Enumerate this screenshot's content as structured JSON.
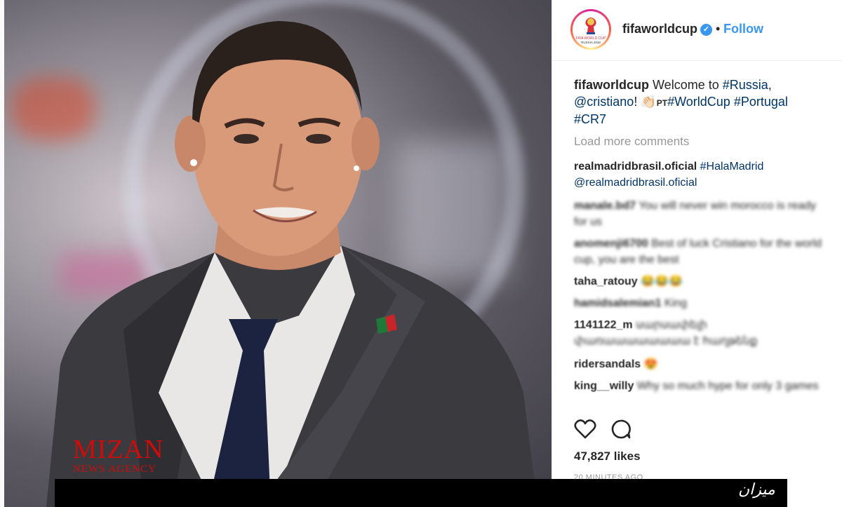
{
  "post": {
    "username": "fifaworldcup",
    "verified_icon": "verified-badge-icon",
    "separator": "•",
    "follow_label": "Follow",
    "caption": {
      "username": "fifaworldcup",
      "text_1": "Welcome to ",
      "tag_russia": "#Russia",
      "text_2": ",",
      "mention": "@cristiano",
      "text_3": "! 👏🏻",
      "pt": "PT",
      "tag_worldcup": "#WorldCup",
      "tag_portugal": "#Portugal",
      "tag_cr7": "#CR7"
    },
    "load_more": "Load more comments",
    "comments": [
      {
        "user": "realmadridbrasil.oficial",
        "text": "#HalaMadrid @realmadridbrasil.oficial"
      },
      {
        "user": "manale.bd7",
        "text": "You will never win morocco is ready for us"
      },
      {
        "user": "anomenji6700",
        "text": "Best of luck Cristiano for the world cup, you are the best"
      },
      {
        "user": "taha_ratouy",
        "text": "😂😂😂"
      },
      {
        "user": "hamidsalemian1",
        "text": "King"
      },
      {
        "user": "1141122_m",
        "text": "սարսափելի փառաաաաաաաա է հաղթենք"
      },
      {
        "user": "ridersandals",
        "text": "😍"
      },
      {
        "user": "king__willy",
        "text": "Why so much hype for only 3 games"
      }
    ],
    "likes": "47,827 likes",
    "time": "20 MINUTES AGO"
  },
  "watermark": {
    "line1": "MIZAN",
    "line2": "NEWS AGENCY",
    "logo_fa": "میزان"
  },
  "colors": {
    "link": "#003569",
    "follow": "#3897f0",
    "watermark": "#d10a0a"
  }
}
